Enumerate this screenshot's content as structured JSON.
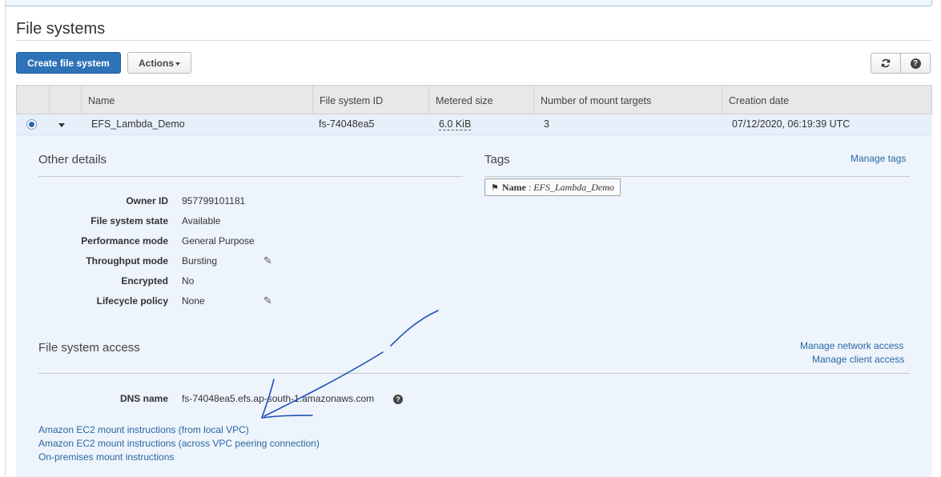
{
  "page": {
    "title": "File systems"
  },
  "toolbar": {
    "create_label": "Create file system",
    "actions_label": "Actions",
    "refresh_icon": "refresh-icon",
    "help_icon": "help-icon"
  },
  "table": {
    "columns": [
      "Name",
      "File system ID",
      "Metered size",
      "Number of mount targets",
      "Creation date"
    ],
    "rows": [
      {
        "name": "EFS_Lambda_Demo",
        "id": "fs-74048ea5",
        "size": "6.0 KiB",
        "mount_targets": "3",
        "created": "07/12/2020, 06:19:39 UTC",
        "selected": true
      }
    ]
  },
  "other_details": {
    "title": "Other details",
    "fields": [
      {
        "label": "Owner ID",
        "value": "957799101181"
      },
      {
        "label": "File system state",
        "value": "Available"
      },
      {
        "label": "Performance mode",
        "value": "General Purpose"
      },
      {
        "label": "Throughput mode",
        "value": "Bursting"
      },
      {
        "label": "Encrypted",
        "value": "No"
      },
      {
        "label": "Lifecycle policy",
        "value": "None"
      }
    ]
  },
  "tags": {
    "title": "Tags",
    "manage_label": "Manage tags",
    "items": [
      {
        "key": "Name",
        "value": "EFS_Lambda_Demo"
      }
    ]
  },
  "access": {
    "title": "File system access",
    "manage_network_label": "Manage network access",
    "manage_client_label": "Manage client access",
    "dns_label": "DNS name",
    "dns_value": "fs-74048ea5.efs.ap-south-1.amazonaws.com",
    "links": [
      "Amazon EC2 mount instructions (from local VPC)",
      "Amazon EC2 mount instructions (across VPC peering connection)",
      "On-premises mount instructions"
    ]
  },
  "colors": {
    "primary": "#2e73b8",
    "link": "#2c67a3",
    "annotation": "#1f4fb5",
    "detail_bg": "#edf4fb"
  }
}
